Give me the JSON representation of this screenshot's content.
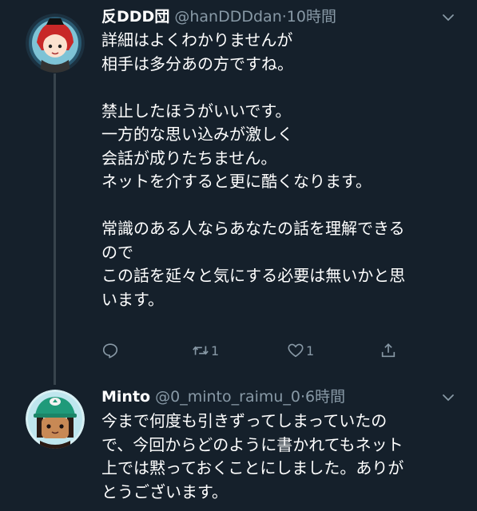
{
  "tweets": [
    {
      "display_name": "反DDD団",
      "handle_time": "@hanDDDdan·10時間",
      "body": "詳細はよくわかりませんが\n相手は多分あの方ですね。\n\n禁止したほうがいいです。\n一方的な思い込みが激しく\n会話が成りたちません。\nネットを介すると更に酷くなります。\n\n常識のある人ならあなたの話を理解できる\nので\nこの話を延々と気にする必要は無いかと思\nいます。",
      "retweet_count": "1",
      "like_count": "1"
    },
    {
      "display_name": "Minto",
      "handle_time": "@0_minto_raimu_0·6時間",
      "body": "今まで何度も引きずってしまっていたの\nで、今回からどのように書かれてもネット\n上では黙っておくことにしました。ありが\nとうございます。"
    }
  ],
  "icons": {
    "reply": "reply-icon",
    "retweet": "retweet-icon",
    "like": "heart-icon",
    "share": "share-icon",
    "menu": "chevron-down-icon"
  },
  "colors": {
    "background": "#15202b",
    "text": "#ffffff",
    "secondary": "#8899a6",
    "thread_line": "#38444d"
  }
}
